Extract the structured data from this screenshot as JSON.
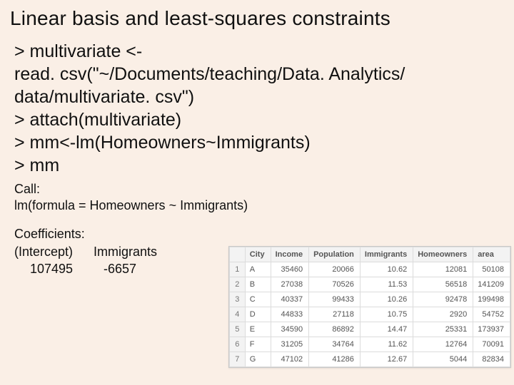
{
  "title": "Linear basis and least-squares constraints",
  "code": {
    "l1": "> multivariate <-",
    "l2": "read. csv(\"~/Documents/teaching/Data. Analytics/",
    "l3": "data/multivariate. csv\")",
    "l4": "> attach(multivariate)",
    "l5": "> mm<-lm(Homeowners~Immigrants)",
    "l6": "> mm"
  },
  "output": {
    "call1": "Call:",
    "call2": "lm(formula = Homeowners ~ Immigrants)",
    "coef_header": "Coefficients:",
    "lab_intercept": "(Intercept)",
    "lab_immigrants": "Immigrants",
    "val_intercept": "107495",
    "val_immigrants": "-6657"
  },
  "sheet": {
    "headers": [
      "City",
      "Income",
      "Population",
      "Immigrants",
      "Homeowners",
      "area"
    ],
    "rows": [
      {
        "n": "1",
        "City": "A",
        "Income": "35460",
        "Population": "20066",
        "Immigrants": "10.62",
        "Homeowners": "12081",
        "area": "50108"
      },
      {
        "n": "2",
        "City": "B",
        "Income": "27038",
        "Population": "70526",
        "Immigrants": "11.53",
        "Homeowners": "56518",
        "area": "141209"
      },
      {
        "n": "3",
        "City": "C",
        "Income": "40337",
        "Population": "99433",
        "Immigrants": "10.26",
        "Homeowners": "92478",
        "area": "199498"
      },
      {
        "n": "4",
        "City": "D",
        "Income": "44833",
        "Population": "27118",
        "Immigrants": "10.75",
        "Homeowners": "2920",
        "area": "54752"
      },
      {
        "n": "5",
        "City": "E",
        "Income": "34590",
        "Population": "86892",
        "Immigrants": "14.47",
        "Homeowners": "25331",
        "area": "173937"
      },
      {
        "n": "6",
        "City": "F",
        "Income": "31205",
        "Population": "34764",
        "Immigrants": "11.62",
        "Homeowners": "12764",
        "area": "70091"
      },
      {
        "n": "7",
        "City": "G",
        "Income": "47102",
        "Population": "41286",
        "Immigrants": "12.67",
        "Homeowners": "5044",
        "area": "82834"
      }
    ]
  }
}
